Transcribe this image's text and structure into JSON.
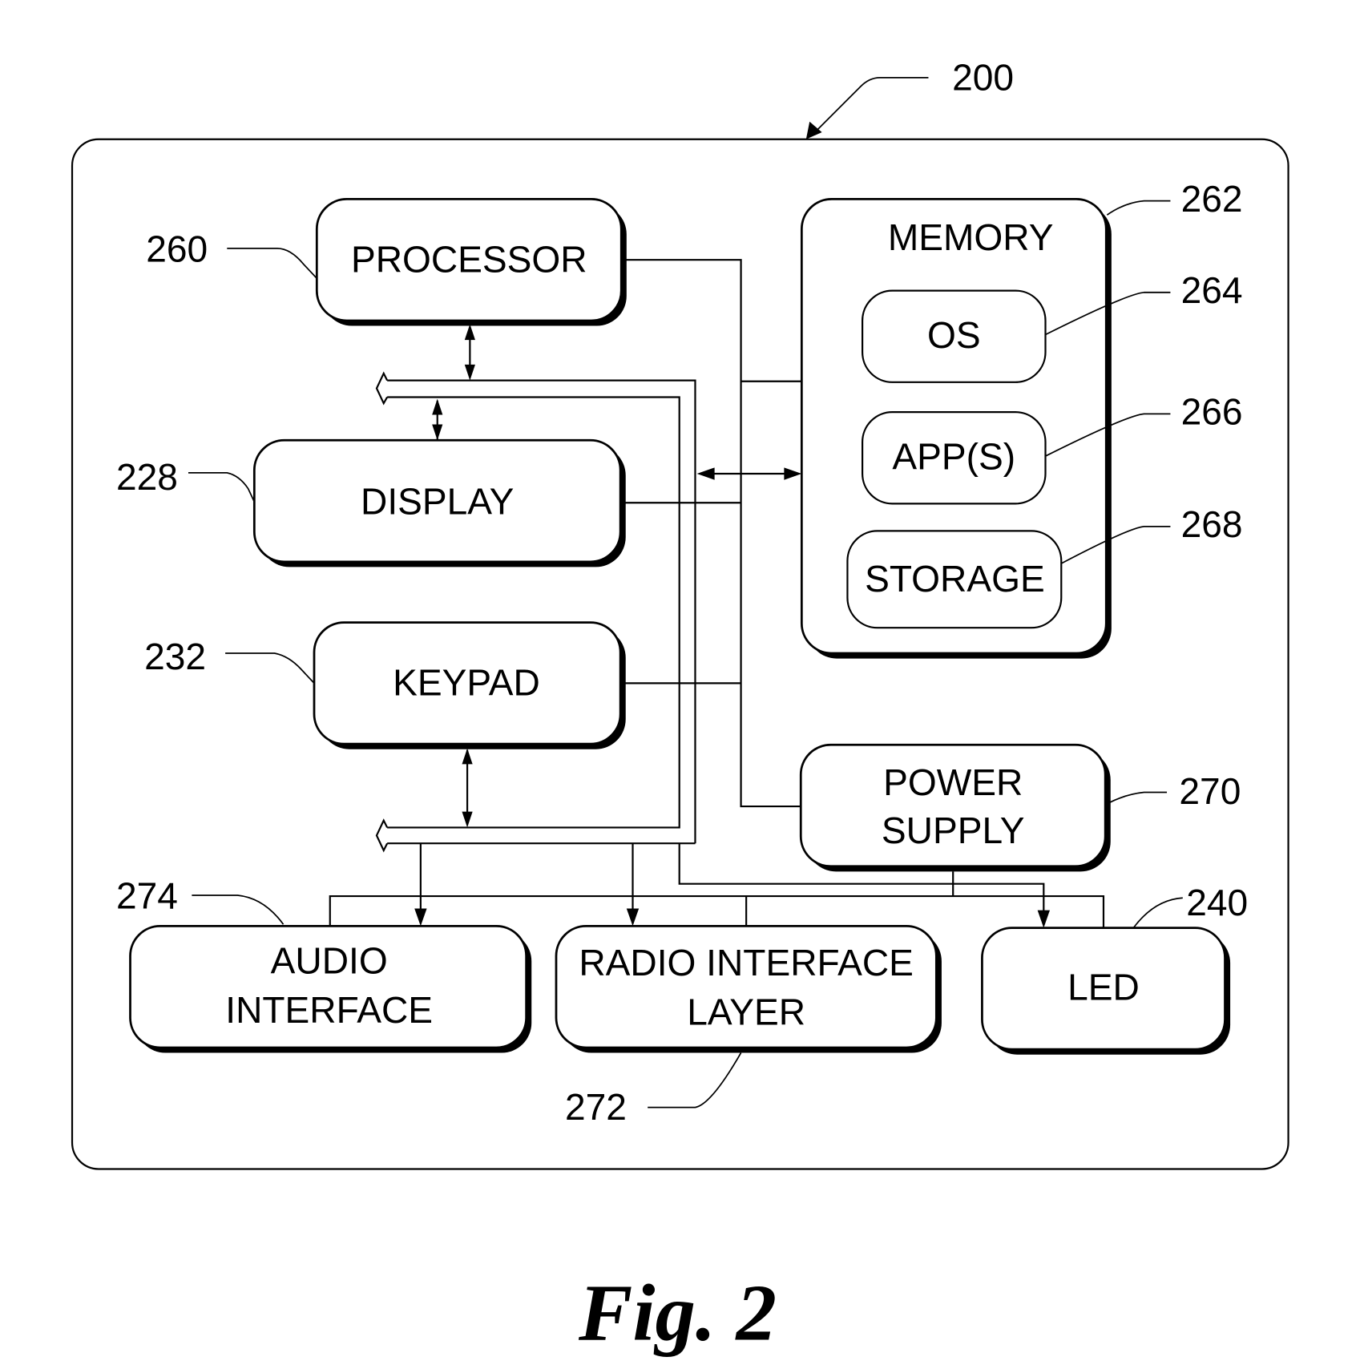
{
  "figure": {
    "caption": "Fig. 2",
    "device_ref": "200"
  },
  "blocks": {
    "processor": {
      "label": "PROCESSOR",
      "ref": "260"
    },
    "display": {
      "label": "DISPLAY",
      "ref": "228"
    },
    "keypad": {
      "label": "KEYPAD",
      "ref": "232"
    },
    "memory": {
      "label": "MEMORY",
      "ref": "262"
    },
    "os": {
      "label": "OS",
      "ref": "264"
    },
    "apps": {
      "label": "APP(S)",
      "ref": "266"
    },
    "storage": {
      "label": "STORAGE",
      "ref": "268"
    },
    "power_supply": {
      "label_line1": "POWER",
      "label_line2": "SUPPLY",
      "ref": "270"
    },
    "audio_interface": {
      "label_line1": "AUDIO",
      "label_line2": "INTERFACE",
      "ref": "274"
    },
    "radio_interface_layer": {
      "label_line1": "RADIO INTERFACE",
      "label_line2": "LAYER",
      "ref": "272"
    },
    "led": {
      "label": "LED",
      "ref": "240"
    }
  }
}
